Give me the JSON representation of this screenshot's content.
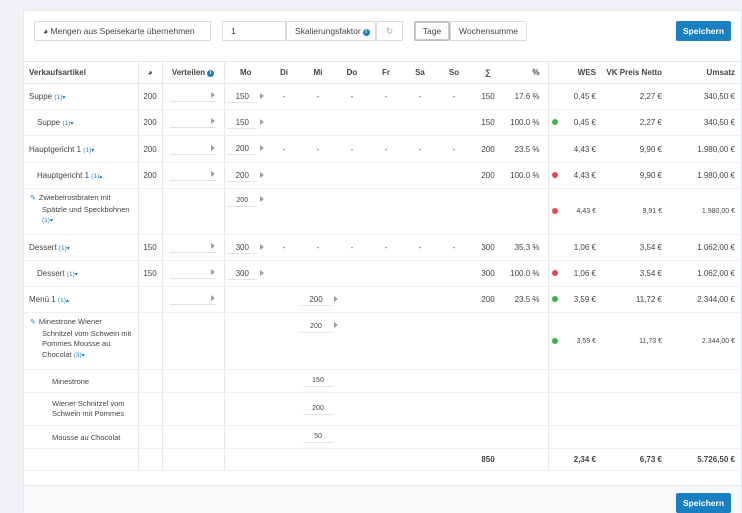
{
  "toolbar": {
    "mengen_label": "Mengen aus Speisekarte übernehmen",
    "factor_value": "1",
    "factor_label": "Skalierungsfaktor",
    "tage": "Tage",
    "wochensumme": "Wochensumme",
    "save": "Speichern"
  },
  "table": {
    "headers": {
      "artikel": "Verkaufsartikel",
      "verteilen": "Verteilen",
      "mo": "Mo",
      "di": "Di",
      "mi": "Mi",
      "do": "Do",
      "fr": "Fr",
      "sa": "Sa",
      "so": "So",
      "sum": "∑",
      "pct": "%",
      "wes": "WES",
      "vk": "VK Preis Netto",
      "umsatz": "Umsatz"
    },
    "rows": [
      {
        "name": "Suppe",
        "cnt": "(1)",
        "qty": "200",
        "mo": "150",
        "di": "-",
        "mi": "-",
        "do": "-",
        "fr": "-",
        "sa": "-",
        "so": "-",
        "sum": "150",
        "pct": "17.6 %",
        "wes": "0,45 €",
        "vk": "2,27 €",
        "ums": "340,50 €"
      },
      {
        "name": "Suppe",
        "cnt": "(1)",
        "qty": "200",
        "mo": "150",
        "sum": "150",
        "pct": "100.0 %",
        "wes": "0,45 €",
        "vk": "2,27 €",
        "ums": "340,50 €"
      },
      {
        "name": "Hauptgericht 1",
        "cnt": "(1)",
        "qty": "200",
        "mo": "200",
        "di": "-",
        "mi": "-",
        "do": "-",
        "fr": "-",
        "sa": "-",
        "so": "-",
        "sum": "200",
        "pct": "23.5 %",
        "wes": "4,43 €",
        "vk": "9,90 €",
        "ums": "1.980,00 €"
      },
      {
        "name": "Hauptgericht 1",
        "cnt": "(1)",
        "qty": "200",
        "mo": "200",
        "sum": "200",
        "pct": "100.0 %",
        "wes": "4,43 €",
        "vk": "9,90 €",
        "ums": "1.980,00 €"
      },
      {
        "name": "Zwiebelrostbraten mit Spätzle und Speckbohnen",
        "cnt": "(1)",
        "mo": "200",
        "wes": "4,43 €",
        "vk": "9,91 €",
        "ums": "1.980,00 €"
      },
      {
        "name": "Dessert",
        "cnt": "(1)",
        "qty": "150",
        "mo": "300",
        "di": "-",
        "mi": "-",
        "do": "-",
        "fr": "-",
        "sa": "-",
        "so": "-",
        "sum": "300",
        "pct": "35.3 %",
        "wes": "1,06 €",
        "vk": "3,54 €",
        "ums": "1.062,00 €"
      },
      {
        "name": "Dessert",
        "cnt": "(1)",
        "qty": "150",
        "mo": "300",
        "sum": "300",
        "pct": "100.0 %",
        "wes": "1,06 €",
        "vk": "3,54 €",
        "ums": "1.062,00 €"
      },
      {
        "name": "Menü 1",
        "cnt": "(1)",
        "mi": "200",
        "sum": "200",
        "pct": "23.5 %",
        "wes": "3,59 €",
        "vk": "11,72 €",
        "ums": "2.344,00 €"
      },
      {
        "name": "Minestrone Wiener Schnitzel vom Schwein mit Pommes Mousse au Chocolat",
        "cnt": "(3)",
        "mi": "200",
        "wes": "3,59 €",
        "vk": "11,73 €",
        "ums": "2.344,00 €"
      },
      {
        "name": "Minestrone",
        "mi": "150"
      },
      {
        "name": "Wiener Schnitzel vom Schwein mit Pommes",
        "mi": "200"
      },
      {
        "name": "Mousse au Chocolat",
        "mi": "50"
      }
    ],
    "totals": {
      "sum": "850",
      "wes": "2,34 €",
      "vk": "6,73 €",
      "ums": "5.726,50 €"
    }
  },
  "colors": {
    "primary": "#1a7fc1",
    "green": "#3cb44b",
    "red": "#e8484f"
  },
  "icons": {
    "mengen": "pie-chart-icon",
    "refresh": "refresh-icon",
    "info": "info-icon",
    "edit": "pencil-icon",
    "caret": "caret-down-icon"
  }
}
